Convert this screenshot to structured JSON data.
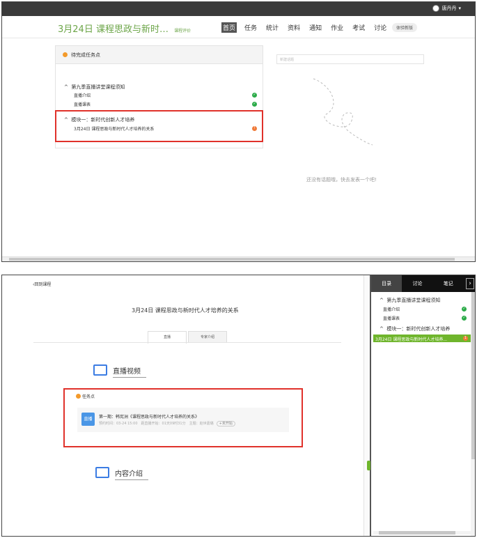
{
  "top": {
    "user_name": "唐丹丹",
    "course_title": "3月24日 课程思政与新时…",
    "course_sub": "课程评价",
    "nav": [
      "首页",
      "任务",
      "统计",
      "资料",
      "通知",
      "作业",
      "考试",
      "讨论"
    ],
    "new_version": "体验新版",
    "panel_title": "待完成任务点",
    "group1": "第九季直播讲堂课程须知",
    "group1_items": [
      "直播介绍",
      "直播课表"
    ],
    "group2": "模块一：新时代创新人才培养",
    "group2_item": "3月24日 课程思政与新时代人才培养的关系",
    "group2_badge": "!",
    "search_placeholder": "新建话题",
    "empty_text": "还没有话题哦，快去发表一个吧!"
  },
  "bottom": {
    "back": "回到课程",
    "lesson_title": "3月24日 课程思政与新时代人才培养的关系",
    "tabs": [
      "直播",
      "专家介绍"
    ],
    "section_video": "直播视频",
    "task_label": "任务点",
    "live_badge": "直播",
    "task_title": "第一期：韩宪洲《课程思政与新时代人才培养的关系》",
    "task_meta": "预约时间：03-24 15:00　距直播开始：01天09时31分　主题：赵世嘉璐",
    "not_started": "未开始",
    "section_intro": "内容介绍",
    "right_tabs": [
      "目录",
      "讨论",
      "笔记"
    ],
    "right_group1": "第九季直播讲堂课程须知",
    "right_items": [
      "直播介绍",
      "直播课表"
    ],
    "right_group2": "模块一：新时代创新人才培养",
    "right_active": "3月24日 课程思政与新时代人才培养...",
    "right_active_badge": "1"
  },
  "colors": {
    "accent": "#6ca548",
    "highlight": "#e0312a",
    "ok": "#2bab48",
    "warn": "#f07b3a",
    "live": "#4a96e6"
  },
  "icons": [
    "user-avatar-icon",
    "chevron-down-icon",
    "check-icon",
    "warning-icon",
    "back-chevron-icon",
    "tv-icon",
    "book-icon",
    "chevron-right-icon"
  ]
}
